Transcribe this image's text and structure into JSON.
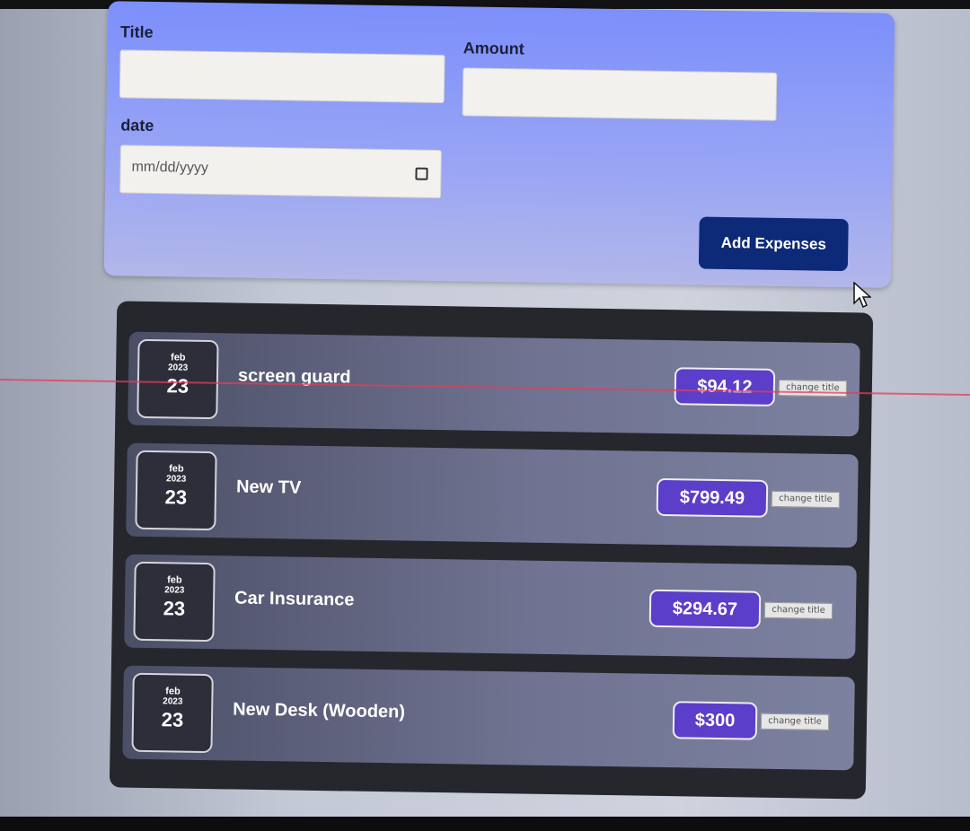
{
  "form": {
    "title_label": "Title",
    "amount_label": "Amount",
    "date_label": "date",
    "title_value": "",
    "amount_value": "",
    "date_placeholder": "mm/dd/yyyy",
    "submit_label": "Add Expenses",
    "icons": [
      "calendar-icon",
      "mouse-cursor-icon"
    ]
  },
  "colors": {
    "form_bg": "#8b97f7",
    "button_bg": "#0d2a78",
    "list_bg": "#26272d",
    "amount_bg": "#5b3ec9"
  },
  "expenses": [
    {
      "month": "feb",
      "year": "2023",
      "day": "23",
      "title": "screen guard",
      "amount": "$94.12",
      "action": "change title"
    },
    {
      "month": "feb",
      "year": "2023",
      "day": "23",
      "title": "New TV",
      "amount": "$799.49",
      "action": "change title"
    },
    {
      "month": "feb",
      "year": "2023",
      "day": "23",
      "title": "Car Insurance",
      "amount": "$294.67",
      "action": "change title"
    },
    {
      "month": "feb",
      "year": "2023",
      "day": "23",
      "title": "New Desk (Wooden)",
      "amount": "$300",
      "action": "change title"
    }
  ]
}
